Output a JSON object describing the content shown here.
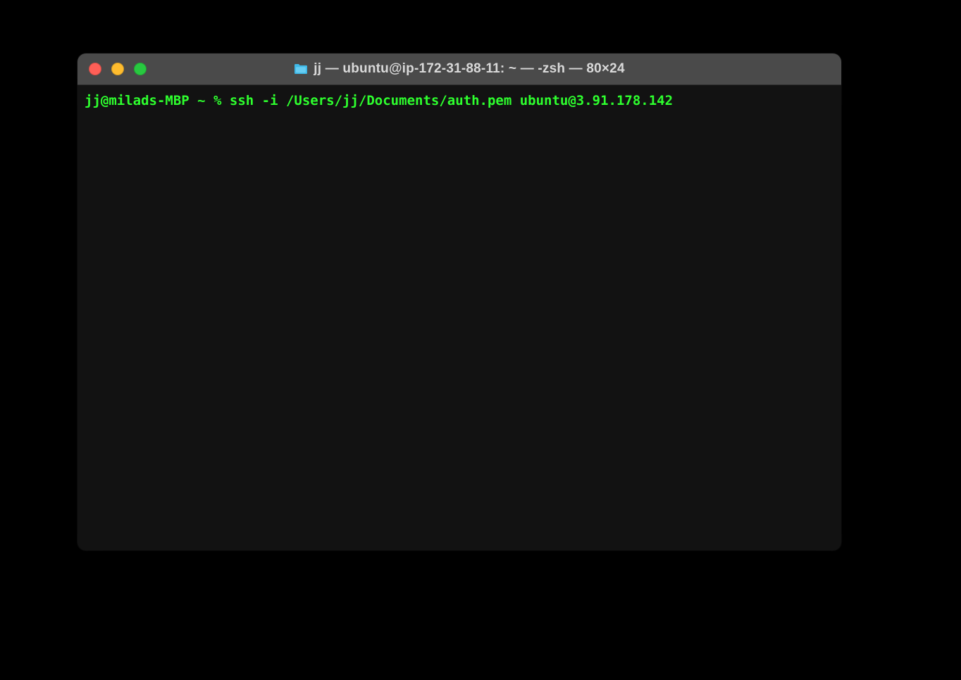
{
  "window": {
    "title": "jj — ubuntu@ip-172-31-88-11: ~ — -zsh — 80×24",
    "icon": "folder-icon"
  },
  "terminal": {
    "prompt": "jj@milads-MBP ~ % ",
    "command": "ssh -i /Users/jj/Documents/auth.pem ubuntu@3.91.178.142"
  },
  "colors": {
    "text": "#2EFF2E",
    "titlebar_bg": "#4a4a4a",
    "body_bg": "#121212"
  }
}
